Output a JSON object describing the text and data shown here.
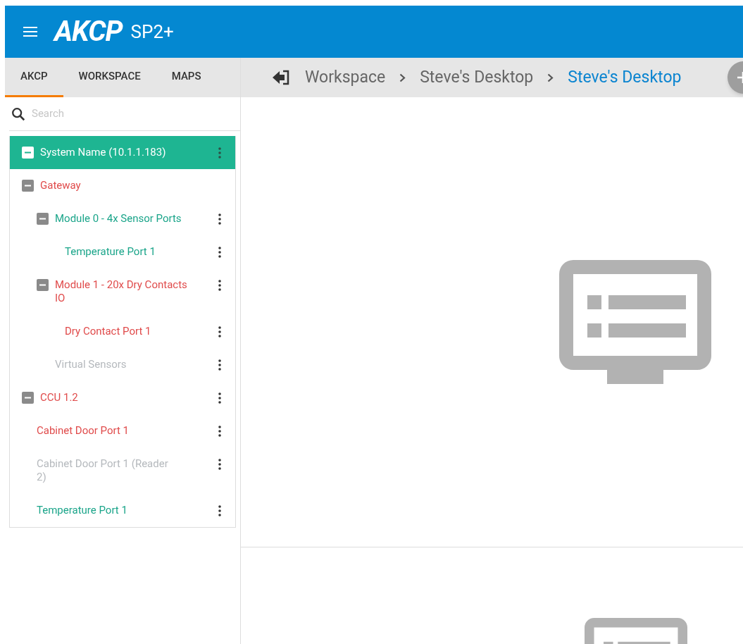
{
  "header": {
    "logo": "AKCP",
    "product": "SP2+"
  },
  "tabs": [
    {
      "label": "AKCP",
      "selected": true
    },
    {
      "label": "WORKSPACE",
      "selected": false
    },
    {
      "label": "MAPS",
      "selected": false
    }
  ],
  "search": {
    "placeholder": "Search"
  },
  "tree": [
    {
      "label": "System Name (10.1.1.183)",
      "selected": true,
      "expanded": true,
      "menu": true,
      "color": "#ffffff",
      "children": [
        {
          "label": "Gateway",
          "selected": false,
          "expanded": true,
          "menu": false,
          "color": "#e04b4b",
          "children": [
            {
              "label": "Module 0 - 4x Sensor Ports",
              "selected": false,
              "expanded": true,
              "menu": true,
              "color": "#1ba58a",
              "children": [
                {
                  "label": "Temperature Port 1",
                  "selected": false,
                  "menu": true,
                  "color": "#1ba58a"
                }
              ]
            },
            {
              "label": "Module 1 - 20x Dry Contacts IO",
              "selected": false,
              "expanded": true,
              "menu": true,
              "color": "#e04b4b",
              "children": [
                {
                  "label": "Dry Contact Port 1",
                  "selected": false,
                  "menu": true,
                  "color": "#e04b4b"
                }
              ]
            },
            {
              "label": "Virtual Sensors",
              "selected": false,
              "menu": true,
              "color": "#b5b9bd"
            }
          ]
        },
        {
          "label": "CCU 1.2",
          "selected": false,
          "expanded": true,
          "menu": true,
          "color": "#e04b4b",
          "children": [
            {
              "label": "Cabinet Door Port 1",
              "selected": false,
              "menu": true,
              "color": "#e04b4b"
            },
            {
              "label": "Cabinet Door Port 1 (Reader 2)",
              "selected": false,
              "menu": true,
              "color": "#b5b9bd"
            },
            {
              "label": "Temperature Port 1",
              "selected": false,
              "menu": true,
              "color": "#1ba58a"
            }
          ]
        }
      ]
    }
  ],
  "breadcrumb": [
    {
      "label": "Workspace",
      "selected": false
    },
    {
      "label": "Steve's Desktop",
      "selected": false
    },
    {
      "label": "Steve's Desktop",
      "selected": true
    }
  ]
}
